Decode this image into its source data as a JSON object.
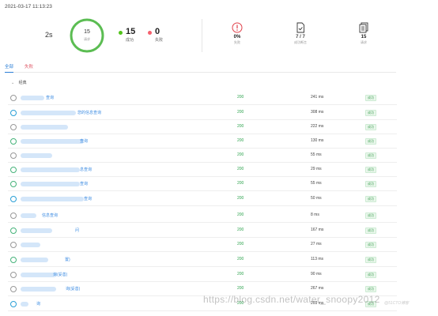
{
  "timestamp": "2021-03-17 11:13:23",
  "summary": {
    "duration": "2s",
    "ring": {
      "count": "15",
      "label": "请求",
      "success_fraction": 1.0,
      "color": "#5bbd52"
    },
    "success": {
      "count": "15",
      "label": "成功",
      "color": "#52c41a"
    },
    "fail": {
      "count": "0",
      "label": "失败",
      "color": "#f5606e"
    }
  },
  "metrics": {
    "fail_rate": {
      "icon": "alert-circle-icon",
      "value": "0%",
      "label": "失败",
      "color": "#e0404a"
    },
    "assertions": {
      "icon": "file-check-icon",
      "value": "7 / 7",
      "label": "成功断言"
    },
    "requests": {
      "icon": "documents-icon",
      "value": "15",
      "label": "请求"
    }
  },
  "tabs": [
    {
      "label": "全部",
      "active": true
    },
    {
      "label": "失败",
      "active": false
    }
  ],
  "group": {
    "label": "经典"
  },
  "rows": [
    {
      "index": "1",
      "name": "查询",
      "code": "200",
      "time": "241 ms",
      "status": "成功"
    },
    {
      "index": "2",
      "name": "您的信息查询",
      "code": "200",
      "time": "308 ms",
      "status": "成功"
    },
    {
      "index": "3",
      "name": "",
      "code": "200",
      "time": "222 ms",
      "status": "成功"
    },
    {
      "index": "4",
      "name": "查询",
      "code": "200",
      "time": "130 ms",
      "status": "成功"
    },
    {
      "index": "5",
      "name": "",
      "code": "200",
      "time": "55 ms",
      "status": "成功"
    },
    {
      "index": "6",
      "name": "息查询",
      "code": "200",
      "time": "29 ms",
      "status": "成功"
    },
    {
      "index": "7",
      "name": "查询",
      "code": "200",
      "time": "55 ms",
      "status": "成功"
    },
    {
      "index": "8",
      "name": "查询",
      "code": "200",
      "time": "50 ms",
      "status": "成功"
    },
    {
      "index": "9",
      "name": "信息查询",
      "code": "200",
      "time": "8 ms",
      "status": "成功"
    },
    {
      "index": "10",
      "name": "问",
      "code": "200",
      "time": "167 ms",
      "status": "成功"
    },
    {
      "index": "11",
      "name": "",
      "code": "200",
      "time": "27 ms",
      "status": "成功"
    },
    {
      "index": "12",
      "name": "置)",
      "code": "200",
      "time": "113 ms",
      "status": "成功"
    },
    {
      "index": "13",
      "name": "询(妥善)",
      "code": "200",
      "time": "90 ms",
      "status": "成功"
    },
    {
      "index": "14",
      "name": "询(妥善)",
      "code": "200",
      "time": "267 ms",
      "status": "成功"
    },
    {
      "index": "15",
      "name": "询",
      "code": "200",
      "time": "203 ms",
      "status": "成功"
    }
  ],
  "watermark": "https://blog.csdn.net/water_snoopy2012",
  "corner_mark": "@51CTO博客"
}
